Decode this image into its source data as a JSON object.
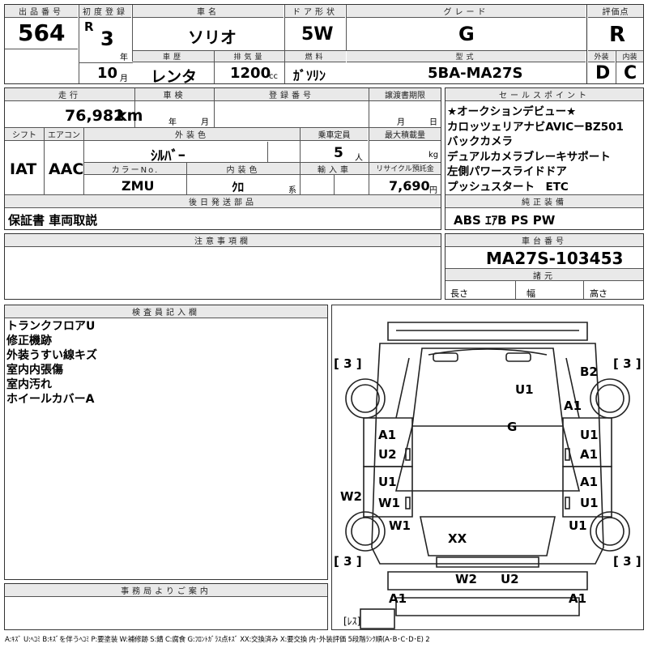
{
  "headers": {
    "lot_no": "出品番号",
    "first_reg": "初度登録",
    "car_name": "車名",
    "door": "ドア形状",
    "grade": "グレード",
    "score": "評価点",
    "history": "車歴",
    "displacement": "排気量",
    "fuel": "燃料",
    "model_type": "型式",
    "exterior": "外装",
    "interior": "内装",
    "mileage": "走行",
    "inspection": "車検",
    "reg_no": "登録番号",
    "transfer_doc": "譲渡書期限",
    "sales_point": "セールスポイント",
    "shift": "シフト",
    "aircon": "エアコン",
    "color": "外装色",
    "capacity": "乗車定員",
    "max_load": "最大積載量",
    "color_no": "カラーNo.",
    "int_color": "内装色",
    "import": "輸入車",
    "recycle": "リサイクル預託金",
    "later_parts": "後日発送部品",
    "std_equipment": "純正装備",
    "notes": "注意事項欄",
    "chassis_no": "車台番号",
    "specs": "諸元",
    "inspector": "検査員記入欄",
    "office": "事務局よりご案内"
  },
  "vehicle": {
    "lot_no": "564",
    "era": "R",
    "year": "3",
    "year_unit": "年",
    "month": "10",
    "month_unit": "月",
    "car_name": "ソリオ",
    "door": "5W",
    "grade": "G",
    "score": "R",
    "history": "レンタ",
    "displacement": "1200",
    "displacement_unit": "cc",
    "fuel": "ｶﾞｿﾘﾝ",
    "model_type": "5BA-MA27S",
    "exterior_grade": "D",
    "interior_grade": "C",
    "mileage": "76,982",
    "mileage_unit": "km",
    "insp_year_unit": "年",
    "insp_month_unit": "月",
    "transfer_month_unit": "月",
    "transfer_day_unit": "日",
    "shift": "IAT",
    "aircon": "AAC",
    "color": "ｼﾙﾊﾞｰ",
    "capacity": "5",
    "capacity_unit": "人",
    "max_load_unit": "kg",
    "color_no": "ZMU",
    "int_color": "ｸﾛ",
    "int_color_unit": "系",
    "recycle": "7,690",
    "recycle_unit": "円",
    "later_parts": "保証書 車両取説",
    "std_equipment": "ABS ｴｱB PS PW",
    "chassis_no": "MA27S-103453",
    "length_label": "長さ",
    "width_label": "幅",
    "height_label": "高さ"
  },
  "sales_points": [
    "★オークションデビュー★",
    "カロッツェリアナビAVICーBZ501",
    "バックカメラ",
    "デュアルカメラブレーキサポート",
    "左側パワースライドドア",
    "プッシュスタート　ETC"
  ],
  "inspector_notes": [
    "トランクフロアU",
    "修正機跡",
    "外装うすい線キズ",
    "室内内張傷",
    "室内汚れ",
    "ホイールカバーA"
  ],
  "diagram": {
    "tire_tl": "[ 3 ]",
    "tire_tr": "[ 3 ]",
    "tire_bl": "[ 3 ]",
    "tire_br": "[ 3 ]",
    "b2": "B2",
    "u1_roof": "U1",
    "a1_rf": "A1",
    "g": "G",
    "a1_lfd": "A1",
    "u2_lfd": "U2",
    "u1_rfd": "U1",
    "a1_rfd": "A1",
    "u1_lrd": "U1",
    "w1_lrd": "W1",
    "a1_rrd": "A1",
    "u1_rrd": "U1",
    "w2_left": "W2",
    "w1_lr": "W1",
    "u1_rr": "U1",
    "xx": "XX",
    "w2_rear": "W2",
    "u2_rear": "U2",
    "a1_bl": "A1",
    "a1_br": "A1",
    "spare": "[ﾚｽ]",
    "zero_l": "0",
    "zero_r": "0",
    "zero_l2": "0",
    "zero_r2": "0"
  },
  "legend": "A:ｷｽﾞ U:ﾍｺﾐ B:ｷｽﾞを伴うﾍｺﾐ P:要塗装 W:補修跡 S:錆 C:腐食 G:ﾌﾛﾝﾄｶﾞﾗｽ点ｷｽﾞ XX:交換済み X:要交換 内･外装評価 5段階ﾗﾝｸ順(A･B･C･D･E) 2"
}
